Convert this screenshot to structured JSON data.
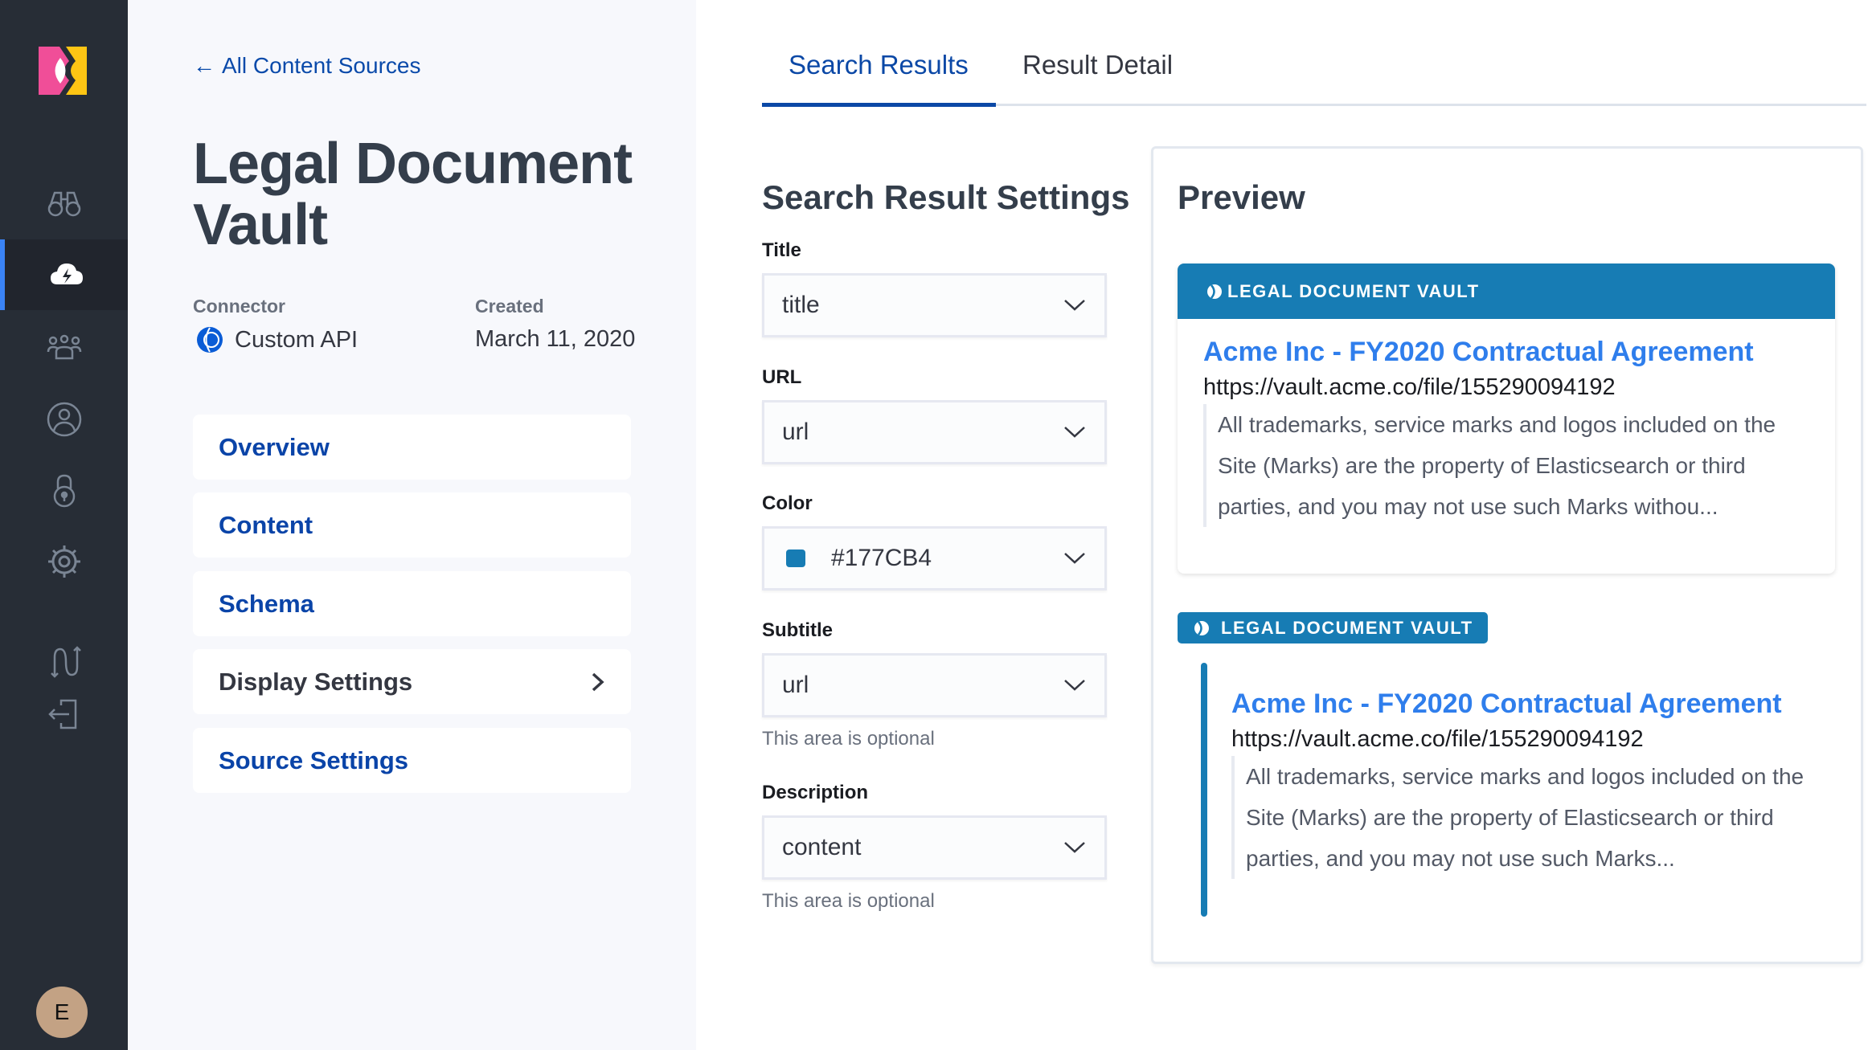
{
  "sidebar": {
    "items": [
      {
        "name": "search",
        "icon": "binoculars-icon",
        "active": false
      },
      {
        "name": "sources",
        "icon": "cloud-bolt-icon",
        "active": true
      },
      {
        "name": "groups",
        "icon": "users-group-icon",
        "active": false
      },
      {
        "name": "user",
        "icon": "user-circle-icon",
        "active": false
      },
      {
        "name": "security",
        "icon": "lock-icon",
        "active": false
      },
      {
        "name": "settings",
        "icon": "gear-icon",
        "active": false
      },
      {
        "name": "switch",
        "icon": "swap-icon",
        "active": false
      },
      {
        "name": "logout",
        "icon": "logout-icon",
        "active": false
      }
    ],
    "avatar_initial": "E"
  },
  "left": {
    "back_link": "All Content Sources",
    "title": "Legal Document Vault",
    "connector_label": "Connector",
    "connector_value": "Custom API",
    "created_label": "Created",
    "created_value": "March 11, 2020",
    "nav": [
      {
        "label": "Overview"
      },
      {
        "label": "Content"
      },
      {
        "label": "Schema"
      },
      {
        "label": "Display Settings",
        "current": true
      },
      {
        "label": "Source Settings"
      }
    ]
  },
  "tabs": [
    {
      "label": "Search Results",
      "active": true
    },
    {
      "label": "Result Detail",
      "active": false
    }
  ],
  "form": {
    "heading": "Search Result Settings",
    "fields": [
      {
        "label": "Title",
        "value": "title"
      },
      {
        "label": "URL",
        "value": "url"
      },
      {
        "label": "Color",
        "value": "#177CB4"
      },
      {
        "label": "Subtitle",
        "value": "url",
        "help": "This area is optional"
      },
      {
        "label": "Description",
        "value": "content",
        "help": "This area is optional"
      }
    ]
  },
  "preview": {
    "heading": "Preview",
    "accent_color": "#177CB4",
    "source_label": "LEGAL DOCUMENT VAULT",
    "result_title": "Acme Inc - FY2020 Contractual Agreement",
    "result_url": "https://vault.acme.co/file/155290094192",
    "card_description": "All trademarks, service marks and logos included on the Site (Marks) are the property of Elasticsearch or third parties, and you may not use such Marks withou...",
    "list_description": "All trademarks, service marks and logos included on the Site (Marks) are the property of Elasticsearch or third parties, and you may not use such Marks..."
  }
}
